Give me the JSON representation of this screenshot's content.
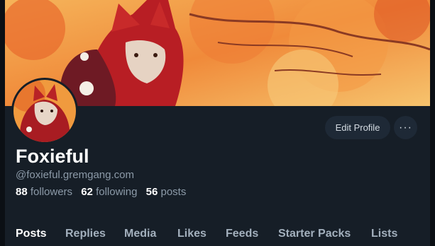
{
  "profile": {
    "display_name": "Foxieful",
    "handle": "@foxieful.gremgang.com",
    "followers_count": "88",
    "followers_label": "followers",
    "following_count": "62",
    "following_label": "following",
    "posts_count": "56",
    "posts_label": "posts"
  },
  "actions": {
    "edit_profile_label": "Edit Profile",
    "more_label": "···"
  },
  "tabs": [
    {
      "label": "Posts",
      "active": true
    },
    {
      "label": "Replies"
    },
    {
      "label": "Media"
    },
    {
      "label": "Likes"
    },
    {
      "label": "Feeds"
    },
    {
      "label": "Starter Packs"
    },
    {
      "label": "Lists"
    }
  ],
  "colors": {
    "background": "#161e27",
    "button": "#1e2936",
    "muted_text": "#8c9aa8"
  },
  "icons": {
    "banner": "autumn-fox-banner-image",
    "avatar": "fox-avatar-image",
    "more": "ellipsis-icon"
  }
}
